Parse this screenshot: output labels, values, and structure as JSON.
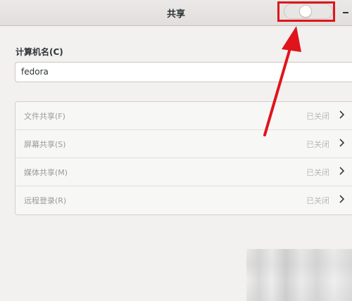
{
  "window": {
    "title": "共享",
    "sharing_toggle_state": "off",
    "minimize_glyph": "–"
  },
  "hostname": {
    "label": "计算机名(C)",
    "value": "fedora"
  },
  "services": [
    {
      "label": "文件共享(F)",
      "status": "已关闭"
    },
    {
      "label": "屏幕共享(S)",
      "status": "已关闭"
    },
    {
      "label": "媒体共享(M)",
      "status": "已关闭"
    },
    {
      "label": "远程登录(R)",
      "status": "已关闭"
    }
  ],
  "annotation": {
    "color": "#e0141b",
    "icon": "arrow-icon"
  }
}
